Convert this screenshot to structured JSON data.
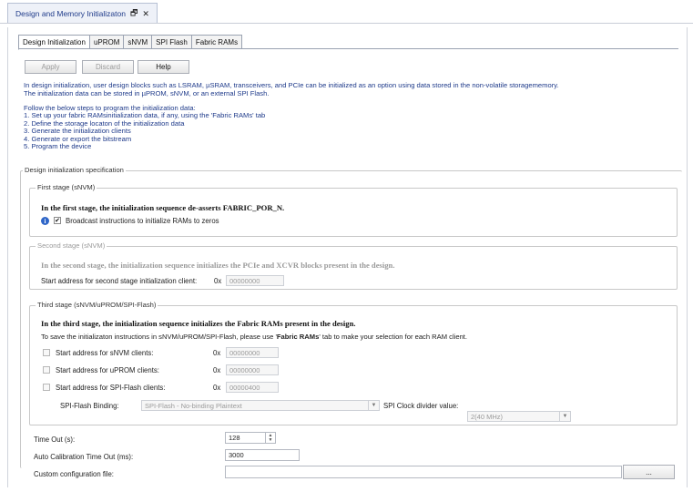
{
  "window": {
    "tab_title": "Design and Memory Initializaton",
    "pin_glyph": "🗗",
    "close_glyph": "✕"
  },
  "subtabs": [
    "Design Initialization",
    "uPROM",
    "sNVM",
    "SPI Flash",
    "Fabric RAMs"
  ],
  "toolbar": {
    "apply": "Apply",
    "discard": "Discard",
    "help": "Help"
  },
  "intro": {
    "line1": "In design initialization, user design blocks such as LSRAM, µSRAM, transceivers, and PCIe can be initialized as an option using data stored in the non-volatile storagememory.",
    "line2": "The initialization data can be stored in µPROM, sNVM, or an external SPI Flash.",
    "steps_title": "Follow the below steps to program the initialization data:",
    "steps": [
      "1. Set up your fabric RAMsinitialization data, if any, using the 'Fabric RAMs' tab",
      "2. Define the storage locaton of the initialization data",
      "3. Generate the initialization clients",
      "4. Generate or export the bitstream",
      "5. Program the device"
    ]
  },
  "spec": {
    "title": "Design initialization specification",
    "first": {
      "title": "First stage (sNVM)",
      "desc": "In the first stage, the initialization sequence de-asserts FABRIC_POR_N.",
      "broadcast_label": "Broadcast instructions to initialize RAMs to zeros",
      "broadcast_checked": true
    },
    "second": {
      "title": "Second stage (sNVM)",
      "desc": "In the second stage, the initialization sequence initializes the PCIe and XCVR blocks present in the design.",
      "addr_label": "Start address for second stage initialization client:",
      "prefix": "0x",
      "addr_value": "00000000"
    },
    "third": {
      "title": "Third stage (sNVM/uPROM/SPI-Flash)",
      "desc": "In the third stage, the initialization sequence initializes the Fabric RAMs present in the design.",
      "note_pre": "To save the initializaton instructions in sNVM/uPROM/SPI-Flash, please use '",
      "note_bold": "Fabric RAMs",
      "note_post": "' tab to make your selection for each RAM client.",
      "prefix": "0x",
      "rows": [
        {
          "label": "Start address for sNVM clients:",
          "value": "00000000"
        },
        {
          "label": "Start address for uPROM clients:",
          "value": "00000000"
        },
        {
          "label": "Start address for SPI-Flash clients:",
          "value": "00000400"
        }
      ],
      "binding_label": "SPI-Flash Binding:",
      "binding_value": "SPI-Flash - No-binding Plaintext",
      "divider_label": "SPI Clock divider value:",
      "divider_value": "2(40 MHz)"
    }
  },
  "bottom": {
    "timeout_label": "Time Out (s):",
    "timeout_value": "128",
    "autocal_label": "Auto Calibration Time Out (ms):",
    "autocal_value": "3000",
    "custom_label": "Custom configuration file:",
    "custom_value": "",
    "browse": "..."
  }
}
